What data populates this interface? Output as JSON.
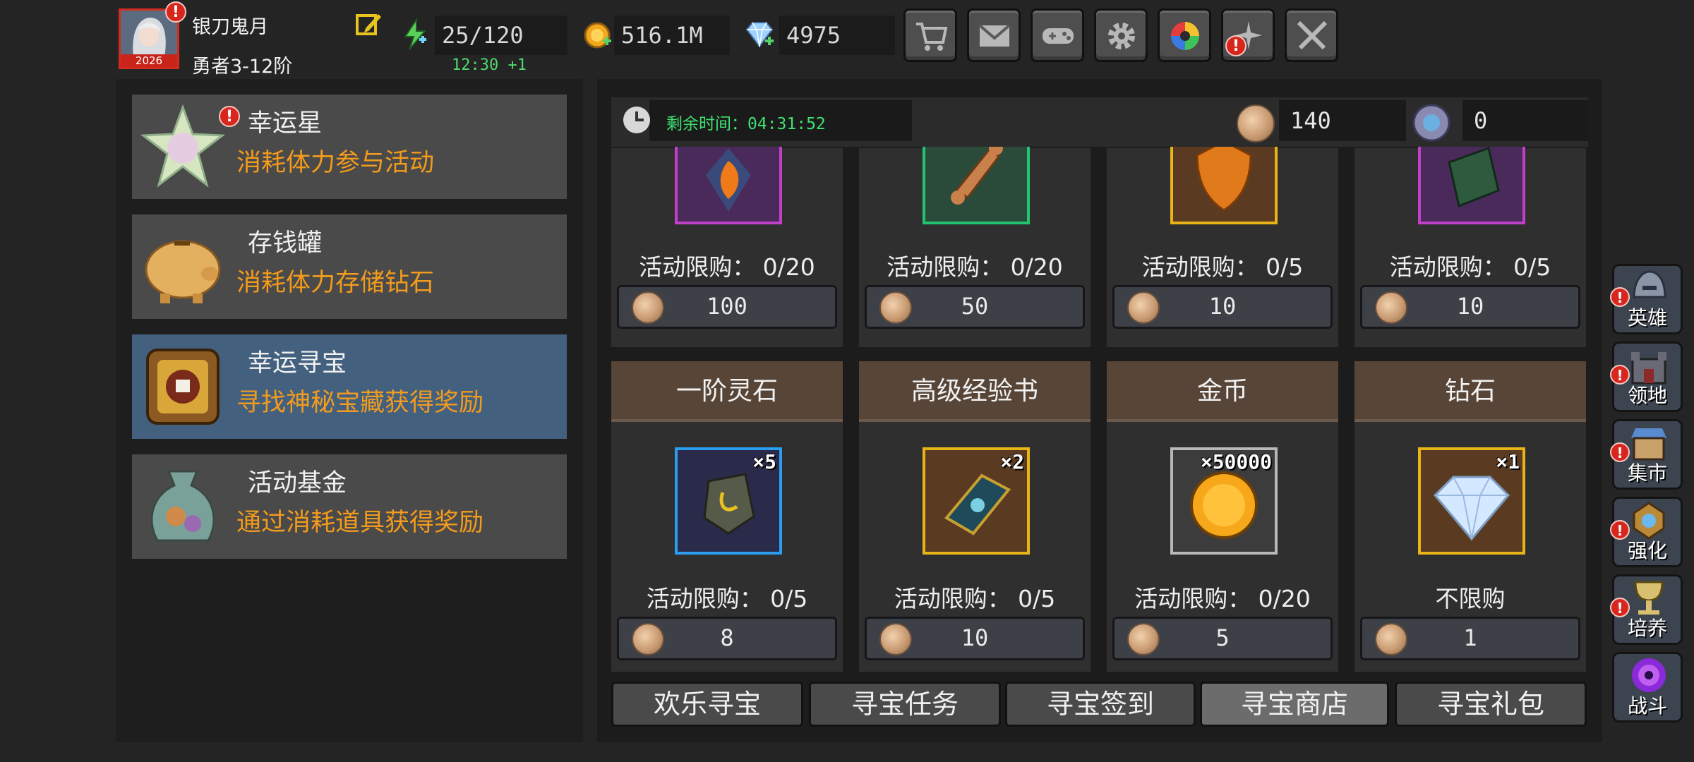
{
  "player": {
    "name": "银刀鬼月",
    "rank": "勇者3-12阶",
    "avatar_year": "2026",
    "alert": "!"
  },
  "resources": {
    "energy": "25/120",
    "energy_regen": "12:30 +1",
    "gold": "516.1M",
    "diamond": "4975"
  },
  "top_buttons": [
    {
      "name": "shop",
      "icon": "cart-icon"
    },
    {
      "name": "mail",
      "icon": "mail-icon"
    },
    {
      "name": "controller",
      "icon": "gamepad-icon"
    },
    {
      "name": "settings",
      "icon": "gear-icon"
    },
    {
      "name": "gacha",
      "icon": "color-wheel-icon"
    },
    {
      "name": "events",
      "icon": "sparkle-icon",
      "alert": "!"
    },
    {
      "name": "battle",
      "icon": "crossed-swords-icon"
    }
  ],
  "activities": [
    {
      "title": "幸运星",
      "desc": "消耗体力参与活动",
      "icon": "lucky-star-icon",
      "alert": "!"
    },
    {
      "title": "存钱罐",
      "desc": "消耗体力存储钻石",
      "icon": "piggy-bank-icon"
    },
    {
      "title": "幸运寻宝",
      "desc": "寻找神秘宝藏获得奖励",
      "icon": "treasure-chest-icon",
      "selected": true
    },
    {
      "title": "活动基金",
      "desc": "通过消耗道具获得奖励",
      "icon": "money-bag-icon"
    }
  ],
  "shop": {
    "timer_label": "剩余时间：04:31:52",
    "currency_a": "140",
    "currency_b": "0",
    "row1": [
      {
        "limit": "活动限购： 0/20",
        "price": "100",
        "frame": "#c040c8",
        "icon": "flame-crystal-icon"
      },
      {
        "limit": "活动限购： 0/20",
        "price": "50",
        "frame": "#22c470",
        "icon": "bone-icon"
      },
      {
        "limit": "活动限购： 0/5",
        "price": "10",
        "frame": "#e8b418",
        "icon": "shield-badge-icon"
      },
      {
        "limit": "活动限购： 0/5",
        "price": "10",
        "frame": "#c040c8",
        "icon": "green-rune-icon"
      }
    ],
    "row2": [
      {
        "name": "一阶灵石",
        "qty": "×5",
        "limit": "活动限购： 0/5",
        "price": "8",
        "frame": "#2a9ef0",
        "icon": "spirit-stone-icon"
      },
      {
        "name": "高级经验书",
        "qty": "×2",
        "limit": "活动限购： 0/5",
        "price": "10",
        "frame": "#e8b418",
        "icon": "exp-book-icon"
      },
      {
        "name": "金币",
        "qty": "×50000",
        "limit": "活动限购： 0/20",
        "price": "5",
        "frame": "#b8b8b8",
        "icon": "gold-coin-icon"
      },
      {
        "name": "钻石",
        "qty": "×1",
        "limit": "不限购",
        "price": "1",
        "frame": "#e8b418",
        "icon": "diamond-icon"
      }
    ]
  },
  "tabs": [
    {
      "label": "欢乐寻宝"
    },
    {
      "label": "寻宝任务"
    },
    {
      "label": "寻宝签到"
    },
    {
      "label": "寻宝商店",
      "active": true
    },
    {
      "label": "寻宝礼包"
    }
  ],
  "right_nav": [
    {
      "label": "英雄",
      "icon": "helmet-icon",
      "alert": "!"
    },
    {
      "label": "领地",
      "icon": "castle-icon",
      "alert": "!"
    },
    {
      "label": "集市",
      "icon": "market-icon",
      "alert": "!"
    },
    {
      "label": "强化",
      "icon": "enhance-icon",
      "alert": "!"
    },
    {
      "label": "培养",
      "icon": "grail-icon",
      "alert": "!"
    },
    {
      "label": "战斗",
      "icon": "portal-icon"
    }
  ]
}
